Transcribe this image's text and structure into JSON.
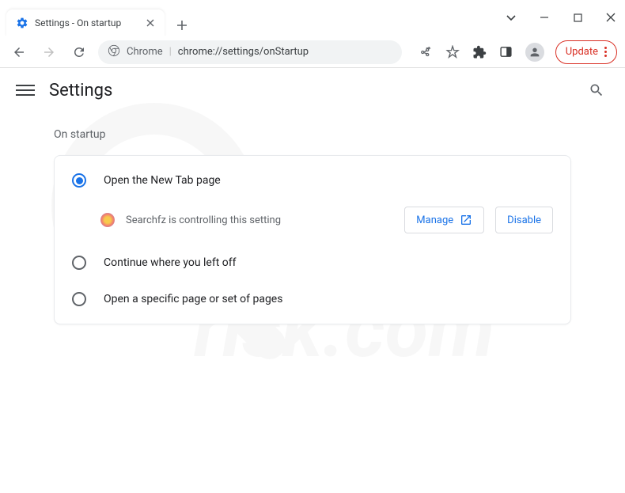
{
  "titlebar": {
    "tab_title": "Settings - On startup"
  },
  "toolbar": {
    "chrome_label": "Chrome",
    "url": "chrome://settings/onStartup",
    "update_label": "Update"
  },
  "header": {
    "title": "Settings"
  },
  "section": {
    "title": "On startup",
    "options": [
      {
        "label": "Open the New Tab page",
        "selected": true
      },
      {
        "label": "Continue where you left off",
        "selected": false
      },
      {
        "label": "Open a specific page or set of pages",
        "selected": false
      }
    ],
    "controlled": {
      "extension_name": "Searchfz",
      "message": "Searchfz is controlling this setting",
      "manage_label": "Manage",
      "disable_label": "Disable"
    }
  }
}
